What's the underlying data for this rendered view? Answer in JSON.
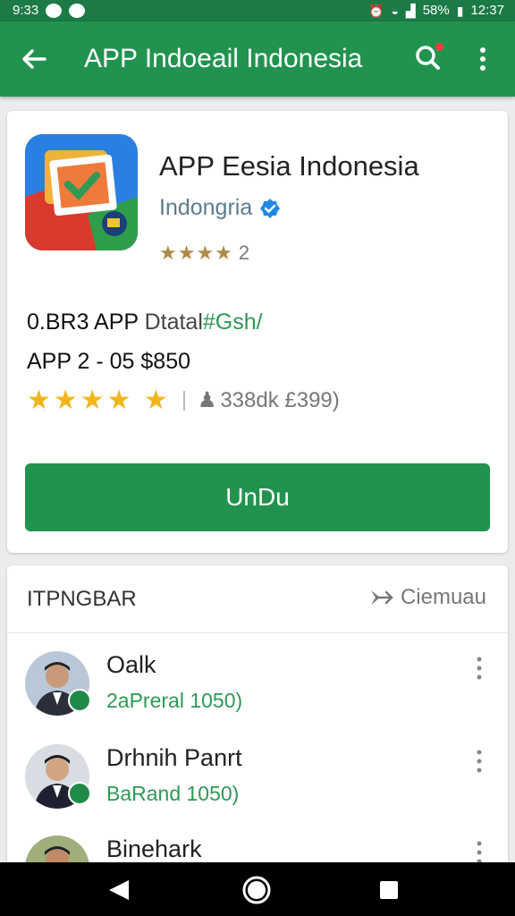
{
  "status_bar": {
    "time_left": "9:33",
    "battery": "58%",
    "time_right": "12:37"
  },
  "app_bar": {
    "title": "APP Indoeail Indonesia"
  },
  "app": {
    "name": "APP Eesia Indonesia",
    "developer": "Indongria",
    "small_rating_count": "2"
  },
  "details": {
    "line1_a": "0.BR3 APP",
    "line1_b": "Dtatal",
    "line1_c": "#Gsh/",
    "line2": "APP 2 - 05 $850",
    "review_count": "338dk £399)"
  },
  "install_button": "UnDu",
  "section": {
    "title": "ITPNGBAR",
    "action_label": "Ciemuau"
  },
  "people": [
    {
      "name": "Oalk",
      "subtitle": "2aPreral 1050)"
    },
    {
      "name": "Drhnih Panrt",
      "subtitle": "BaRand 1050)"
    },
    {
      "name": "Binehark",
      "subtitle": ""
    }
  ],
  "colors": {
    "status_bar": "#1b7a45",
    "app_bar": "#21934f",
    "accent_green": "#2c9a54",
    "star_gold": "#f2b61c",
    "verified_blue": "#1e88e5"
  },
  "icons": [
    "back-arrow-icon",
    "search-icon",
    "more-vert-icon",
    "verified-icon",
    "star-icon",
    "person-icon",
    "share-icon",
    "nav-back-icon",
    "nav-home-icon",
    "nav-recents-icon"
  ]
}
